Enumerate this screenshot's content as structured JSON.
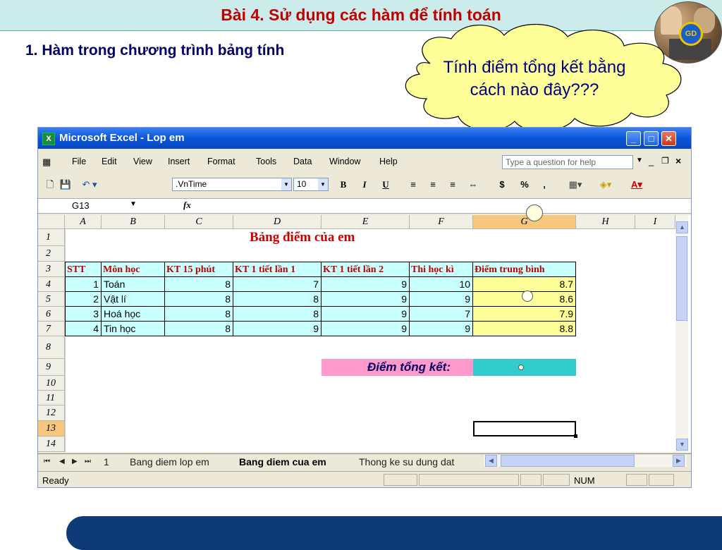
{
  "slide": {
    "title": "Bài 4. Sử dụng các hàm để tính toán",
    "heading": "1. Hàm trong chương trình bảng tính",
    "callout": "Tính điểm tổng kết bằng cách nào đây???",
    "colors": {
      "title": "#c00000",
      "heading": "#000066",
      "title_bar": "#ccecec",
      "footer": "#0e3b78"
    }
  },
  "excel": {
    "window_title": "Microsoft Excel - Lop em",
    "menu": [
      "File",
      "Edit",
      "View",
      "Insert",
      "Format",
      "Tools",
      "Data",
      "Window",
      "Help"
    ],
    "help_placeholder": "Type a question for help",
    "toolbar": {
      "font_name": ".VnTime",
      "font_size": "10",
      "bold": "B",
      "italic": "I",
      "underline": "U",
      "currency": "$",
      "percent": "%",
      "comma": ","
    },
    "name_box": "G13",
    "fx": "fx",
    "columns": [
      "A",
      "B",
      "C",
      "D",
      "E",
      "F",
      "G",
      "H",
      "I"
    ],
    "selected_column": "G",
    "rows": [
      "1",
      "2",
      "3",
      "4",
      "5",
      "6",
      "7",
      "8",
      "9",
      "10",
      "11",
      "12",
      "13",
      "14"
    ],
    "selected_row": "13",
    "sheet_title": "Bảng điểm của em",
    "table_headers": [
      "STT",
      "Môn học",
      "KT 15 phút",
      "KT 1 tiết lần 1",
      "KT 1 tiết lần 2",
      "Thi học kì",
      "Điểm trung bình"
    ],
    "table_rows": [
      {
        "stt": "1",
        "subject": "Toán",
        "kt15": "8",
        "kt1": "7",
        "kt2": "9",
        "hk": "10",
        "avg": "8.7"
      },
      {
        "stt": "2",
        "subject": "Vật lí",
        "kt15": "8",
        "kt1": "8",
        "kt2": "9",
        "hk": "9",
        "avg": "8.6"
      },
      {
        "stt": "3",
        "subject": "Hoá học",
        "kt15": "8",
        "kt1": "8",
        "kt2": "9",
        "hk": "7",
        "avg": "7.9"
      },
      {
        "stt": "4",
        "subject": "Tin học",
        "kt15": "8",
        "kt1": "9",
        "kt2": "9",
        "hk": "9",
        "avg": "8.8"
      }
    ],
    "total_label": "Điểm tổng kết:",
    "sheet_tabs": [
      "1",
      "Bang diem lop em",
      "Bang diem cua em",
      "Thong ke su dung dat"
    ],
    "active_tab": "Bang diem cua em",
    "status": "Ready",
    "num_indicator": "NUM"
  }
}
